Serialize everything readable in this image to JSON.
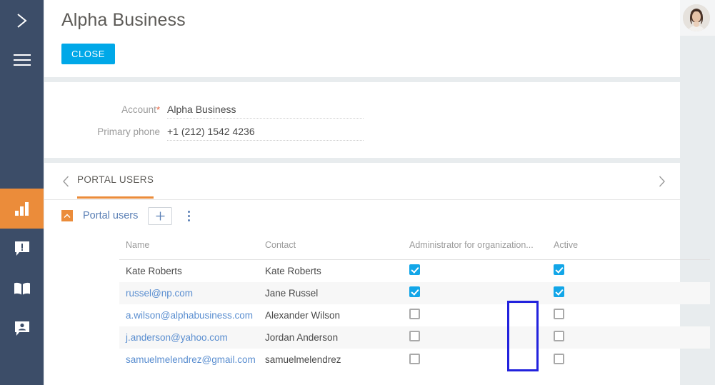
{
  "sidebar": {
    "expander_icon": "chevron-right-icon",
    "menu_icon": "hamburger-icon",
    "items": [
      {
        "icon": "bar-chart-icon",
        "label": "Analytics",
        "active": true
      },
      {
        "icon": "alert-bubble-icon",
        "label": "Notifications",
        "active": false
      },
      {
        "icon": "book-icon",
        "label": "Knowledge base",
        "active": false
      },
      {
        "icon": "contact-bubble-icon",
        "label": "Contacts",
        "active": false
      }
    ]
  },
  "topbar": {
    "avatar_name": "user-avatar"
  },
  "header": {
    "title": "Alpha Business",
    "close_label": "CLOSE"
  },
  "form": {
    "fields": [
      {
        "label": "Account",
        "required": true,
        "value": "Alpha Business"
      },
      {
        "label": "Primary phone",
        "required": false,
        "value": "+1 (212) 1542 4236"
      }
    ],
    "required_marker": "*"
  },
  "tabs": {
    "prev_icon": "chevron-left-icon",
    "next_icon": "chevron-right-icon",
    "items": [
      {
        "label": "PORTAL USERS",
        "active": true
      }
    ]
  },
  "grid": {
    "collapse_icon": "chevron-up-icon",
    "title": "Portal users",
    "add_label": "+",
    "menu_icon": "kebab-menu-icon",
    "columns": [
      "Name",
      "Contact",
      "Administrator for organization...",
      "Active"
    ],
    "rows": [
      {
        "name": "Kate Roberts",
        "name_is_link": false,
        "contact": "Kate Roberts",
        "admin": true,
        "active": true
      },
      {
        "name": "russel@np.com",
        "name_is_link": true,
        "contact": "Jane Russel",
        "admin": true,
        "active": true
      },
      {
        "name": "a.wilson@alphabusiness.com",
        "name_is_link": true,
        "contact": "Alexander Wilson",
        "admin": false,
        "active": false
      },
      {
        "name": "j.anderson@yahoo.com",
        "name_is_link": true,
        "contact": "Jordan Anderson",
        "admin": false,
        "active": false
      },
      {
        "name": "samuelmelendrez@gmail.com",
        "name_is_link": true,
        "contact": "samuelmelendrez",
        "admin": false,
        "active": false
      }
    ]
  },
  "annotation": {
    "target": "active-column-unchecked-checkboxes",
    "color": "#2222dd"
  },
  "colors": {
    "sidebar": "#3c4d68",
    "accent_orange": "#eb8c3a",
    "accent_blue": "#00a8e8",
    "link_blue": "#5a8ed0",
    "page_bg": "#e8ecee"
  }
}
